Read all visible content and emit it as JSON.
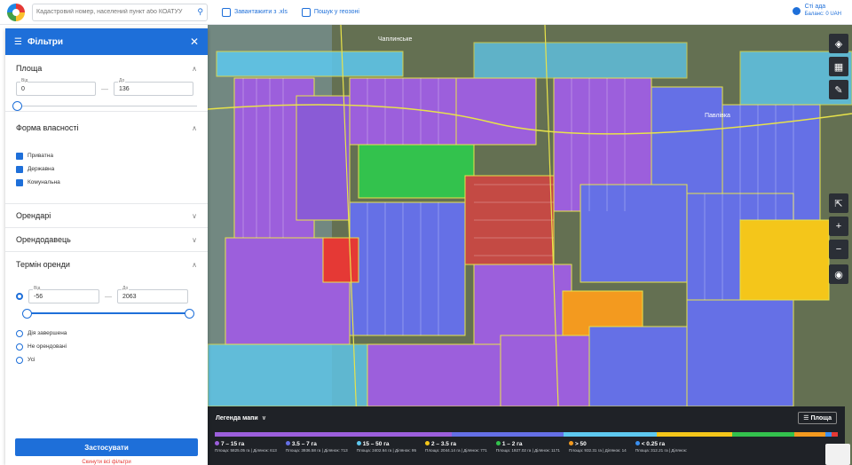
{
  "topbar": {
    "search_placeholder": "Кадастровий номер, населений пункт або КОАТУУ",
    "download_label": "Завантажити з .xls",
    "geozone_label": "Пошук у геозоні",
    "user_name": "Сті             ада",
    "user_balance": "Баланс: 0 UAH"
  },
  "panel": {
    "title": "Фільтри",
    "area": {
      "title": "Площа",
      "from_label": "Від",
      "from_value": "0",
      "to_label": "До",
      "to_value": "136"
    },
    "ownership": {
      "title": "Форма власності",
      "options": [
        "Приватна",
        "Державна",
        "Комунальна"
      ]
    },
    "lessees": {
      "title": "Орендарі"
    },
    "lessors": {
      "title": "Орендодавець"
    },
    "lease_term": {
      "title": "Термін оренди",
      "from_label": "Від",
      "from_value": "-56",
      "to_label": "До",
      "to_value": "2063",
      "options": [
        "Дія завершена",
        "Не орендовані",
        "Усі"
      ]
    },
    "apply_label": "Застосувати",
    "reset_label": "Скинути всі фільтри"
  },
  "map": {
    "place_label_1": "Чаплинське",
    "place_label_2": "Павлівка",
    "controls": [
      "layers-icon",
      "calendar-icon",
      "ruler-icon",
      "fullscreen-icon",
      "zoom-in-icon",
      "zoom-out-icon",
      "locate-icon"
    ],
    "zoom_in": "+",
    "zoom_out": "−"
  },
  "legend": {
    "title": "Легенда мапи",
    "area_button": "Площа",
    "items": [
      {
        "range": "7 – 15 га",
        "stats": "Площа: 5825.05 га | Ділянок: 613",
        "color": "#9c5fdc"
      },
      {
        "range": "3.5 – 7 га",
        "stats": "Площа: 3936.58 га | Ділянок: 713",
        "color": "#6570e6"
      },
      {
        "range": "15 – 50 га",
        "stats": "Площа: 2402.64 га | Ділянок: 95",
        "color": "#5ec9f0"
      },
      {
        "range": "2 – 3.5 га",
        "stats": "Площа: 2044.14 га | Ділянок: 771",
        "color": "#f4c61a"
      },
      {
        "range": "1 – 2 га",
        "stats": "Площа: 1927.02 га | Ділянок: 1171",
        "color": "#33c24d"
      },
      {
        "range": "> 50",
        "stats": "Площа: 932.31 га | Ділянок: 14",
        "color": "#f39a1f"
      },
      {
        "range": "< 0.25 га",
        "stats": "Площа: 312.21 га | Ділянок:",
        "color": "#3a8ff0"
      }
    ],
    "bar_colors": [
      "#9c5fdc",
      "#6570e6",
      "#5ec9f0",
      "#f4c61a",
      "#33c24d",
      "#f39a1f",
      "#3a8ff0",
      "#e53935"
    ]
  }
}
